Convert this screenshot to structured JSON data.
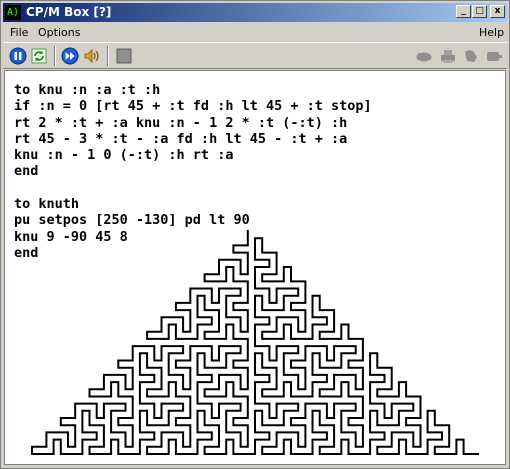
{
  "window": {
    "title": "CP/M Box [?]",
    "app_icon": "A)"
  },
  "title_buttons": {
    "minimize": "_",
    "maximize": "□",
    "close": "x"
  },
  "menu": {
    "file": "File",
    "options": "Options",
    "help": "Help"
  },
  "toolbar": {
    "left_icons": [
      "pause-icon",
      "refresh-icon",
      "forward-icon",
      "speaker-icon",
      "stop-icon"
    ],
    "right_icons": [
      "disk-icon",
      "printer-icon",
      "drive-icon",
      "tape-icon"
    ]
  },
  "screen": {
    "code_lines": [
      "to knu :n :a :t :h",
      "if :n = 0 [rt 45 + :t fd :h lt 45 + :t stop]",
      "rt 2 * :t + :a knu :n - 1 2 * :t (-:t) :h",
      "rt 45 - 3 * :t - :a fd :h lt 45 - :t + :a",
      "knu :n - 1 0 (-:t) :h rt :a",
      "end",
      "",
      "to knuth",
      "pu setpos [250 -130] pd lt 90",
      "knu 9 -90 45 8",
      "end"
    ]
  },
  "colors": {
    "title_start": "#0a246a",
    "title_end": "#a6caf0",
    "chrome": "#d4d0c8"
  }
}
